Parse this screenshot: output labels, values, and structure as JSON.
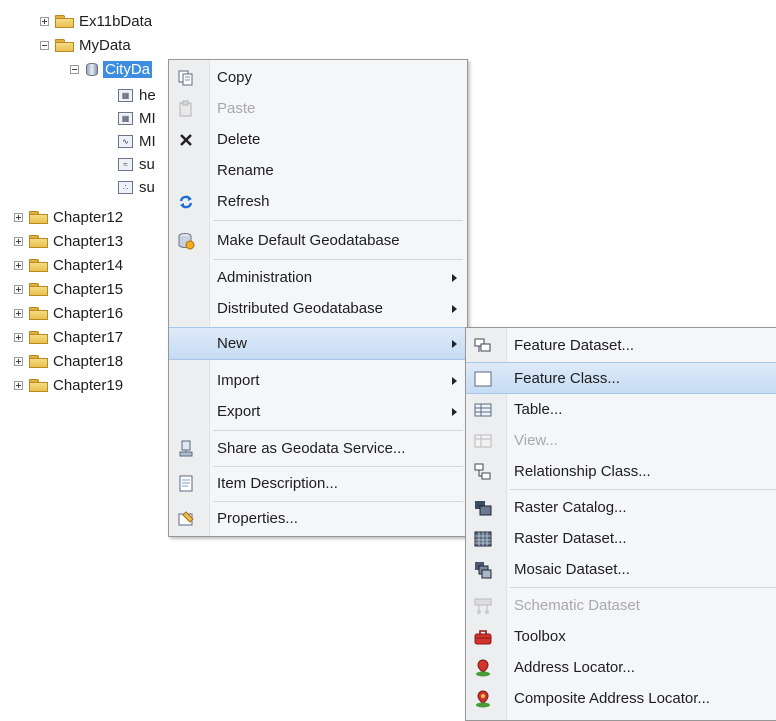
{
  "tree": {
    "top_items": [
      {
        "label": "Ex11bData",
        "expanded": false
      },
      {
        "label": "MyData",
        "expanded": true
      }
    ],
    "geodatabase": {
      "label": "CityDa",
      "expanded": true
    },
    "feature_classes": [
      {
        "label": "he",
        "icon": "raster-icon",
        "glyph": "▦"
      },
      {
        "label": "MI",
        "icon": "raster-icon",
        "glyph": "▦"
      },
      {
        "label": "MI",
        "icon": "line-feature-icon",
        "glyph": "∿"
      },
      {
        "label": "su",
        "icon": "line-feature-icon",
        "glyph": "≈"
      },
      {
        "label": "su",
        "icon": "point-feature-icon",
        "glyph": "∴"
      }
    ],
    "chapters": [
      "Chapter12",
      "Chapter13",
      "Chapter14",
      "Chapter15",
      "Chapter16",
      "Chapter17",
      "Chapter18",
      "Chapter19"
    ]
  },
  "context_menu": {
    "items": [
      {
        "label": "Copy",
        "icon": "copy-icon"
      },
      {
        "label": "Paste",
        "icon": "paste-icon",
        "disabled": true
      },
      {
        "label": "Delete",
        "icon": "delete-icon"
      },
      {
        "label": "Rename",
        "icon": ""
      },
      {
        "label": "Refresh",
        "icon": "refresh-icon"
      },
      {
        "label": "Make Default Geodatabase",
        "icon": "default-geodatabase-icon"
      },
      {
        "label": "Administration",
        "submenu": true
      },
      {
        "label": "Distributed Geodatabase",
        "submenu": true
      },
      {
        "label": "New",
        "submenu": true,
        "highlighted": true
      },
      {
        "label": "Import",
        "submenu": true
      },
      {
        "label": "Export",
        "submenu": true
      },
      {
        "label": "Share as Geodata Service...",
        "icon": "share-service-icon"
      },
      {
        "label": "Item Description...",
        "icon": "item-description-icon"
      },
      {
        "label": "Properties...",
        "icon": "properties-icon"
      }
    ]
  },
  "new_submenu": {
    "items": [
      {
        "label": "Feature Dataset...",
        "icon": "feature-dataset-icon"
      },
      {
        "label": "Feature Class...",
        "icon": "feature-class-icon",
        "highlighted": true
      },
      {
        "label": "Table...",
        "icon": "table-icon"
      },
      {
        "label": "View...",
        "icon": "view-icon",
        "disabled": true
      },
      {
        "label": "Relationship Class...",
        "icon": "relationship-class-icon"
      },
      {
        "label": "Raster Catalog...",
        "icon": "raster-catalog-icon"
      },
      {
        "label": "Raster Dataset...",
        "icon": "raster-dataset-icon"
      },
      {
        "label": "Mosaic Dataset...",
        "icon": "mosaic-dataset-icon"
      },
      {
        "label": "Schematic Dataset",
        "icon": "schematic-dataset-icon",
        "disabled": true
      },
      {
        "label": "Toolbox",
        "icon": "toolbox-icon"
      },
      {
        "label": "Address Locator...",
        "icon": "address-locator-icon"
      },
      {
        "label": "Composite Address Locator...",
        "icon": "composite-address-locator-icon"
      }
    ]
  },
  "colors": {
    "selection": "#3d8ee0",
    "menu_highlight": "#c6dcf4",
    "disabled_text": "#a9a9a9"
  }
}
